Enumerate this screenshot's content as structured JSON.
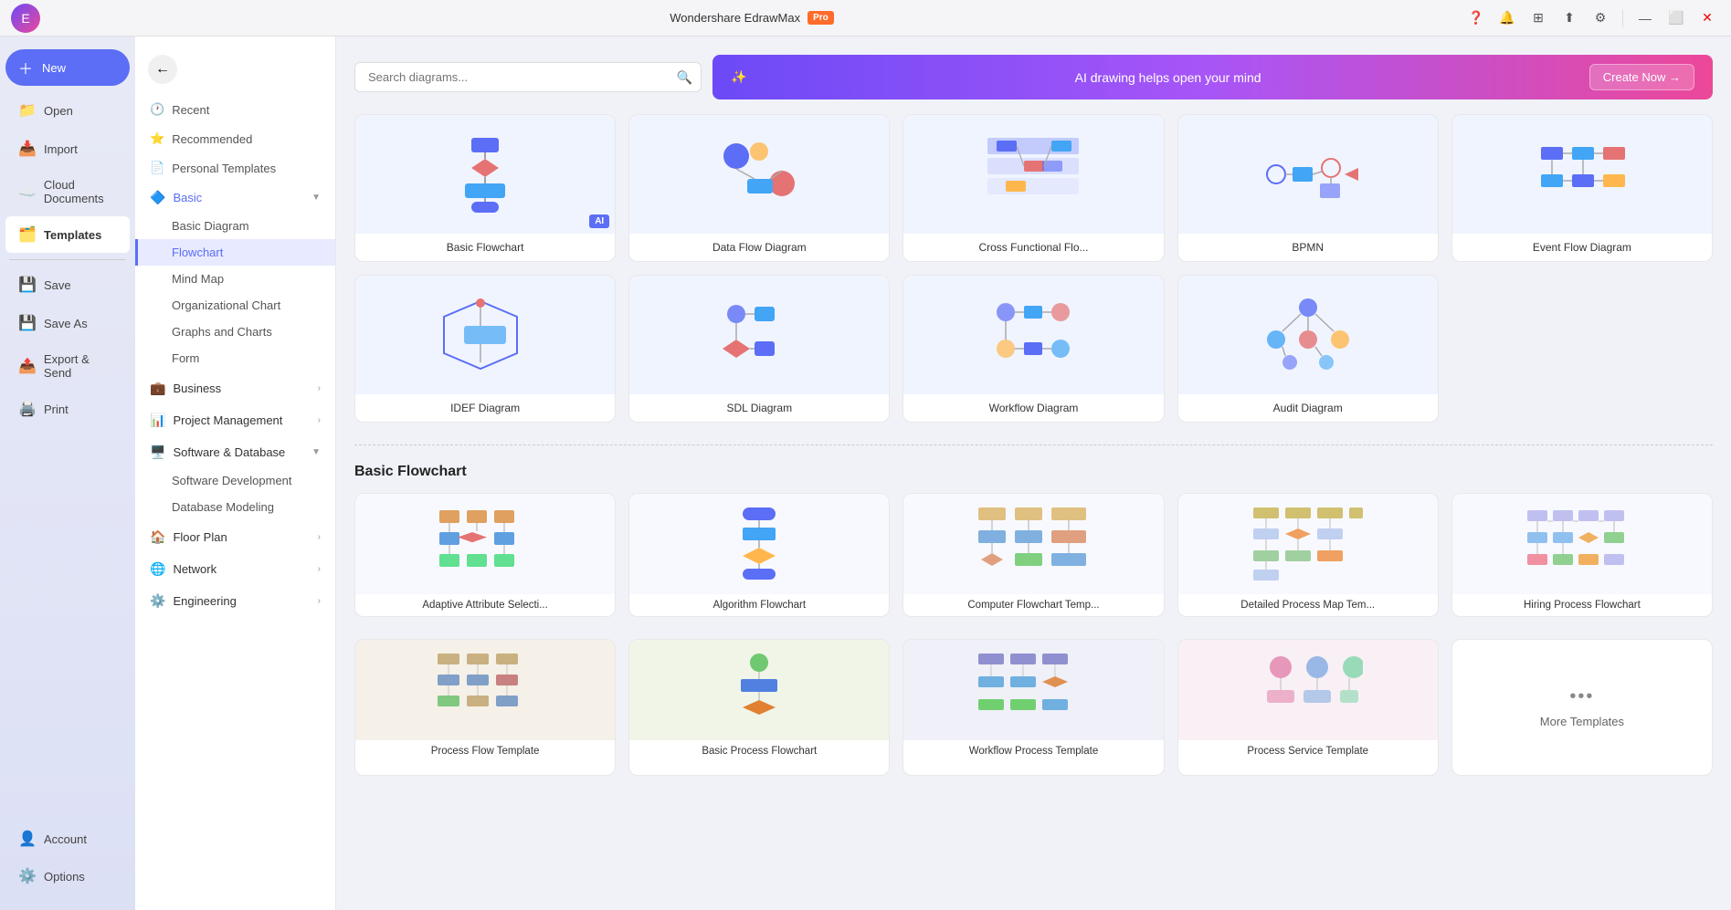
{
  "titleBar": {
    "appName": "Wondershare EdrawMax",
    "proBadge": "Pro",
    "controls": {
      "minimize": "—",
      "maximize": "⬜",
      "close": "✕"
    }
  },
  "sidebar": {
    "items": [
      {
        "id": "new",
        "label": "New",
        "icon": "➕"
      },
      {
        "id": "open",
        "label": "Open",
        "icon": "📁"
      },
      {
        "id": "import",
        "label": "Import",
        "icon": "📥"
      },
      {
        "id": "cloud",
        "label": "Cloud Documents",
        "icon": "☁️"
      },
      {
        "id": "templates",
        "label": "Templates",
        "icon": "🗂️",
        "active": true
      },
      {
        "id": "save",
        "label": "Save",
        "icon": "💾"
      },
      {
        "id": "saveAs",
        "label": "Save As",
        "icon": "💾"
      },
      {
        "id": "export",
        "label": "Export & Send",
        "icon": "📤"
      },
      {
        "id": "print",
        "label": "Print",
        "icon": "🖨️"
      }
    ],
    "bottomItems": [
      {
        "id": "account",
        "label": "Account",
        "icon": "👤"
      },
      {
        "id": "options",
        "label": "Options",
        "icon": "⚙️"
      }
    ]
  },
  "navTree": {
    "topItems": [
      {
        "id": "recent",
        "label": "Recent",
        "icon": "🕐"
      },
      {
        "id": "recommended",
        "label": "Recommended",
        "icon": "⭐"
      },
      {
        "id": "personal",
        "label": "Personal Templates",
        "icon": "📄"
      }
    ],
    "sections": [
      {
        "id": "basic",
        "label": "Basic",
        "icon": "🔷",
        "expanded": true,
        "active": true,
        "subItems": [
          {
            "id": "basicDiagram",
            "label": "Basic Diagram"
          },
          {
            "id": "flowchart",
            "label": "Flowchart",
            "active": true
          },
          {
            "id": "mindMap",
            "label": "Mind Map"
          },
          {
            "id": "orgChart",
            "label": "Organizational Chart"
          },
          {
            "id": "graphs",
            "label": "Graphs and Charts"
          },
          {
            "id": "form",
            "label": "Form"
          }
        ]
      },
      {
        "id": "business",
        "label": "Business",
        "icon": "💼",
        "expanded": false
      },
      {
        "id": "projectMgmt",
        "label": "Project Management",
        "icon": "📊",
        "expanded": false
      },
      {
        "id": "softwareDb",
        "label": "Software & Database",
        "icon": "🖥️",
        "expanded": true,
        "subItems": [
          {
            "id": "softwareDev",
            "label": "Software Development"
          },
          {
            "id": "dbModeling",
            "label": "Database Modeling"
          }
        ]
      },
      {
        "id": "floorPlan",
        "label": "Floor Plan",
        "icon": "🏠",
        "expanded": false
      },
      {
        "id": "network",
        "label": "Network",
        "icon": "🌐",
        "expanded": false
      },
      {
        "id": "engineering",
        "label": "Engineering",
        "icon": "⚙️",
        "expanded": false
      }
    ]
  },
  "search": {
    "placeholder": "Search diagrams..."
  },
  "aiBanner": {
    "text": "AI drawing helps open your mind",
    "icon": "✨",
    "buttonLabel": "Create Now →"
  },
  "diagramTypes": [
    {
      "id": "basicFlowchart",
      "label": "Basic Flowchart",
      "aiTag": true
    },
    {
      "id": "dataFlow",
      "label": "Data Flow Diagram",
      "aiTag": false
    },
    {
      "id": "crossFunctional",
      "label": "Cross Functional Flo...",
      "aiTag": false
    },
    {
      "id": "bpmn",
      "label": "BPMN",
      "aiTag": false
    },
    {
      "id": "eventFlow",
      "label": "Event Flow Diagram",
      "aiTag": false
    },
    {
      "id": "idef",
      "label": "IDEF Diagram",
      "aiTag": false
    },
    {
      "id": "sdl",
      "label": "SDL Diagram",
      "aiTag": false
    },
    {
      "id": "workflow",
      "label": "Workflow Diagram",
      "aiTag": false
    },
    {
      "id": "audit",
      "label": "Audit Diagram",
      "aiTag": false
    }
  ],
  "basicFlowchartSection": {
    "title": "Basic Flowchart",
    "templates": [
      {
        "id": "adaptiveAttr",
        "label": "Adaptive Attribute Selecti..."
      },
      {
        "id": "algorithmFC",
        "label": "Algorithm Flowchart"
      },
      {
        "id": "computerFC",
        "label": "Computer Flowchart Temp..."
      },
      {
        "id": "detailedProcess",
        "label": "Detailed Process Map Tem..."
      },
      {
        "id": "hiringProcess",
        "label": "Hiring Process Flowchart"
      }
    ],
    "moreTemplates": {
      "label": "More Templates",
      "dotsIcon": "•••"
    }
  },
  "colors": {
    "accent": "#5b6ef5",
    "proBadge": "#ff6b2b",
    "aiBannerStart": "#6c4af7",
    "aiBannerEnd": "#ec4899"
  }
}
